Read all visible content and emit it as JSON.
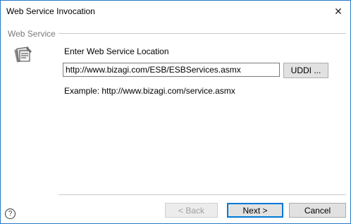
{
  "window": {
    "title": "Web Service Invocation",
    "close_glyph": "✕"
  },
  "section": {
    "label": "Web Service"
  },
  "icons": {
    "web_service": "web-service-icon",
    "help": "help-icon",
    "close": "close-icon"
  },
  "form": {
    "prompt": "Enter Web Service Location",
    "url_value": "http://www.bizagi.com/ESB/ESBServices.asmx",
    "uddi_label": "UDDI ...",
    "example": "Example: http://www.bizagi.com/service.asmx"
  },
  "footer": {
    "help_glyph": "?",
    "back_label": "< Back",
    "next_label": "Next >",
    "cancel_label": "Cancel"
  },
  "colors": {
    "window_border": "#2b78c8",
    "default_button_border": "#0078d7"
  }
}
